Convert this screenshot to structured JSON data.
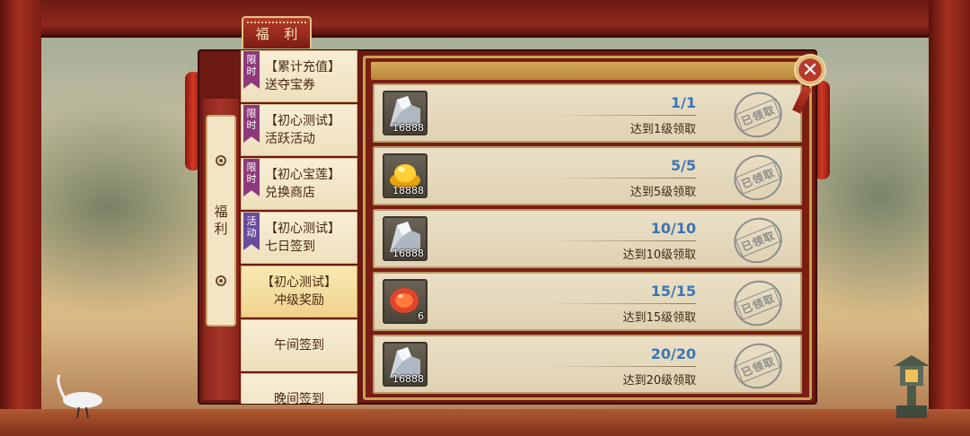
{
  "header_tab": "福 利",
  "side_tab": "福利",
  "menu": [
    {
      "badge": "限时",
      "badge_type": "limited",
      "label": "【累计充值】\n送夺宝券",
      "active": false
    },
    {
      "badge": "限时",
      "badge_type": "limited",
      "label": "【初心测试】\n活跃活动",
      "active": false
    },
    {
      "badge": "限时",
      "badge_type": "limited",
      "label": "【初心宝莲】\n兑换商店",
      "active": false
    },
    {
      "badge": "活动",
      "badge_type": "event",
      "label": "【初心测试】\n七日签到",
      "active": false
    },
    {
      "badge": "",
      "badge_type": "",
      "label": "【初心测试】\n冲级奖励",
      "active": true
    },
    {
      "badge": "",
      "badge_type": "",
      "label": "午间签到",
      "active": false
    },
    {
      "badge": "",
      "badge_type": "",
      "label": "晚间签到",
      "active": false
    }
  ],
  "rewards": [
    {
      "item_icon": "silver-ingot-icon",
      "count": "16888",
      "progress": "1/1",
      "condition": "达到1级领取",
      "status": "已领取"
    },
    {
      "item_icon": "gold-ingot-icon",
      "count": "18888",
      "progress": "5/5",
      "condition": "达到5级领取",
      "status": "已领取"
    },
    {
      "item_icon": "silver-ingot-icon",
      "count": "16888",
      "progress": "10/10",
      "condition": "达到10级领取",
      "status": "已领取"
    },
    {
      "item_icon": "red-gem-icon",
      "count": "6",
      "progress": "15/15",
      "condition": "达到15级领取",
      "status": "已领取"
    },
    {
      "item_icon": "silver-ingot-icon",
      "count": "16888",
      "progress": "20/20",
      "condition": "达到20级领取",
      "status": "已领取"
    }
  ],
  "close_label": "✕",
  "colors": {
    "frame_red": "#7a1e14",
    "gold_trim": "#c9a14f",
    "progress_blue": "#3a76b8",
    "badge_limited": "#8e3a7a",
    "badge_event": "#6a4c9c"
  }
}
